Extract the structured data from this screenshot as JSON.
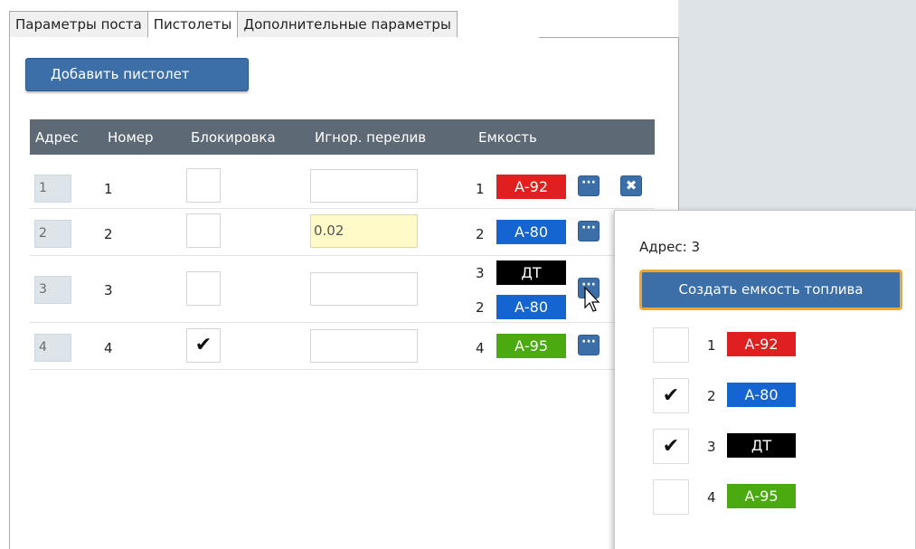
{
  "tabs": [
    {
      "label": "Параметры поста",
      "active": false
    },
    {
      "label": "Пистолеты",
      "active": true
    },
    {
      "label": "Дополнительные параметры",
      "active": false
    }
  ],
  "add_button_label": "Добавить пистолет",
  "table": {
    "columns": [
      "Адрес",
      "Номер",
      "Блокировка",
      "Игнор. перелив",
      "Емкость"
    ],
    "rows": [
      {
        "address": "1",
        "number": "1",
        "blocked": "",
        "ignore_overflow": "",
        "tanks": [
          {
            "num": "1",
            "fuel": "А-92"
          }
        ]
      },
      {
        "address": "2",
        "number": "2",
        "blocked": "",
        "ignore_overflow": "0.02",
        "tanks": [
          {
            "num": "2",
            "fuel": "А-80"
          }
        ]
      },
      {
        "address": "3",
        "number": "3",
        "blocked": "",
        "ignore_overflow": "",
        "tanks": [
          {
            "num": "3",
            "fuel": "ДТ"
          },
          {
            "num": "2",
            "fuel": "А-80"
          }
        ]
      },
      {
        "address": "4",
        "number": "4",
        "blocked": "✔",
        "ignore_overflow": "",
        "tanks": [
          {
            "num": "4",
            "fuel": "А-95"
          }
        ]
      }
    ],
    "dots_label": "···",
    "delete_label": "✖"
  },
  "popup": {
    "title": "Адрес: 3",
    "create_button_label": "Создать емкость топлива",
    "items": [
      {
        "checked": "",
        "num": "1",
        "fuel": "А-92"
      },
      {
        "checked": "✔",
        "num": "2",
        "fuel": "А-80"
      },
      {
        "checked": "✔",
        "num": "3",
        "fuel": "ДТ"
      },
      {
        "checked": "",
        "num": "4",
        "fuel": "А-95"
      }
    ]
  },
  "fuel_colors": {
    "А-92": "#e02020",
    "А-80": "#1464d2",
    "ДТ": "#000000",
    "А-95": "#4aaa10"
  },
  "cursor_icon": "pointer-cursor-icon"
}
